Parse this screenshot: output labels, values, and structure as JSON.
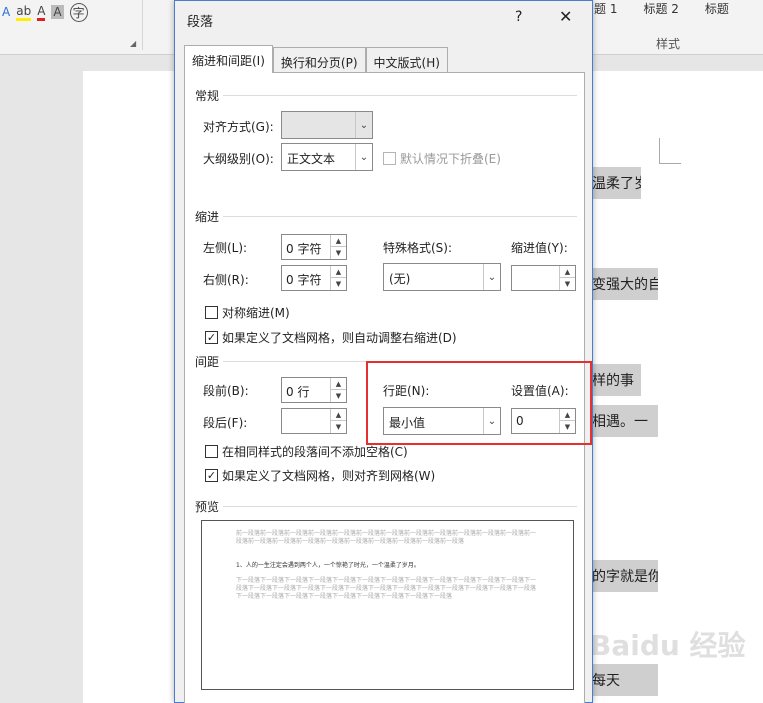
{
  "ribbon": {
    "font_tools": [
      "A",
      "ab",
      "A",
      "A",
      "字"
    ],
    "styles": [
      "题 1",
      "标题 2",
      "标题"
    ],
    "group_label": "样式"
  },
  "document": {
    "lines": [
      "温柔了岁",
      "变强大的自",
      "样的事",
      "相遇。一",
      "的字就是你",
      "每天"
    ]
  },
  "dialog": {
    "title": "段落",
    "help": "?",
    "close": "✕",
    "tabs": [
      "缩进和间距(I)",
      "换行和分页(P)",
      "中文版式(H)"
    ],
    "general": {
      "section": "常规",
      "alignment_label": "对齐方式(G):",
      "alignment_value": "",
      "outline_label": "大纲级别(O):",
      "outline_value": "正文文本",
      "collapse_label": "默认情况下折叠(E)"
    },
    "indent": {
      "section": "缩进",
      "left_label": "左侧(L):",
      "left_value": "0 字符",
      "right_label": "右侧(R):",
      "right_value": "0 字符",
      "special_label": "特殊格式(S):",
      "special_value": "(无)",
      "indent_by_label": "缩进值(Y):",
      "indent_by_value": "",
      "mirror_label": "对称缩进(M)",
      "auto_adjust_label": "如果定义了文档网格，则自动调整右缩进(D)",
      "auto_adjust_checked": true
    },
    "spacing": {
      "section": "间距",
      "before_label": "段前(B):",
      "before_value": "0 行",
      "after_label": "段后(F):",
      "after_value": "",
      "line_spacing_label": "行距(N):",
      "line_spacing_value": "最小值",
      "at_label": "设置值(A):",
      "at_value": "0",
      "no_space_label": "在相同样式的段落间不添加空格(C)",
      "snap_grid_label": "如果定义了文档网格，则对齐到网格(W)",
      "snap_grid_checked": true
    },
    "preview": {
      "section": "预览",
      "prev_text": "前一段落前一段落前一段落前一段落前一段落前一段落前一段落前一段落前一段落前一段落前一段落前一段落前一段落前一段落前一段落前一段落前一段落前一段落前一段落前一段落前一段落前一段落",
      "sample": "1、人的一生注定会遇到两个人，一个惊艳了时光，一个温柔了岁月。",
      "next_text": "下一段落下一段落下一段落下一段落下一段落下一段落下一段落下一段落下一段落下一段落下一段落下一段落下一段落下一段落下一段落下一段落下一段落下一段落下一段落下一段落下一段落下一段落下一段落下一段落下一段落下一段落下一段落下一段落下一段落下一段落下一段落下一段落下一段落下一段落"
    }
  },
  "watermark": "Baidu 经验"
}
